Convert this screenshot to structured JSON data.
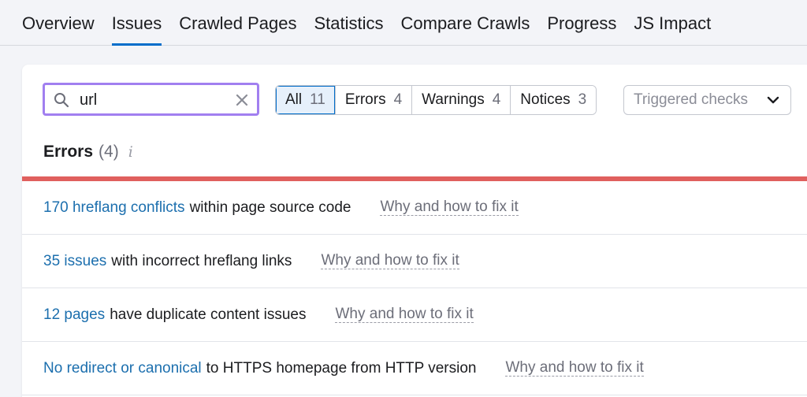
{
  "tabs": [
    {
      "label": "Overview"
    },
    {
      "label": "Issues"
    },
    {
      "label": "Crawled Pages"
    },
    {
      "label": "Statistics"
    },
    {
      "label": "Compare Crawls"
    },
    {
      "label": "Progress"
    },
    {
      "label": "JS Impact"
    }
  ],
  "active_tab": "Issues",
  "search": {
    "value": "url"
  },
  "filters": [
    {
      "label": "All",
      "count": "11"
    },
    {
      "label": "Errors",
      "count": "4"
    },
    {
      "label": "Warnings",
      "count": "4"
    },
    {
      "label": "Notices",
      "count": "3"
    }
  ],
  "triggered": {
    "placeholder": "Triggered checks"
  },
  "section": {
    "title": "Errors",
    "count": "(4)",
    "info": "i"
  },
  "issues": [
    {
      "link": "170 hreflang conflicts",
      "text": "within page source code",
      "fix": "Why and how to fix it"
    },
    {
      "link": "35 issues",
      "text": "with incorrect hreflang links",
      "fix": "Why and how to fix it"
    },
    {
      "link": "12 pages",
      "text": "have duplicate content issues",
      "fix": "Why and how to fix it"
    },
    {
      "link": "No redirect or canonical",
      "text": "to HTTPS homepage from HTTP version",
      "fix": "Why and how to fix it"
    }
  ],
  "colors": {
    "accent": "#006dca",
    "search_focus": "#a17ff0",
    "error_bar": "#e0605e",
    "link": "#1c6fae"
  }
}
